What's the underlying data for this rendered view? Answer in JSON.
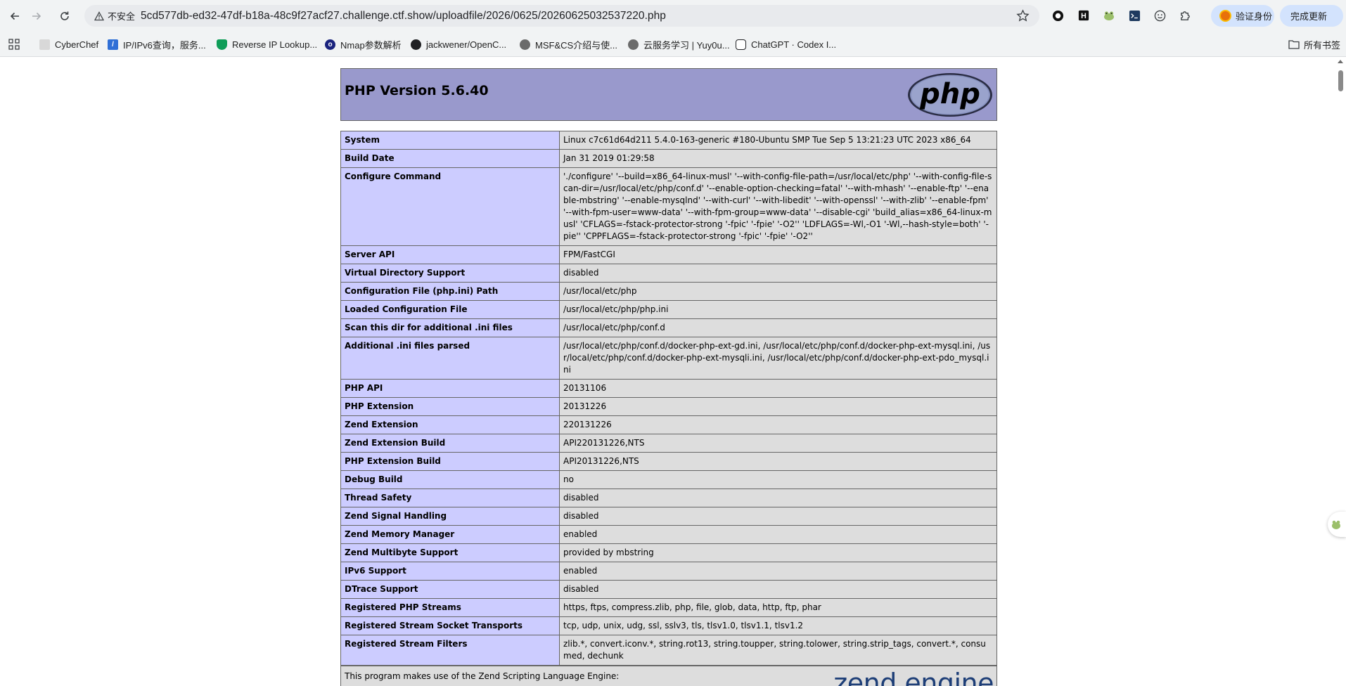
{
  "browser": {
    "security_label": "不安全",
    "url": "5cd577db-ed32-47df-b18a-48c9f27acf27.challenge.ctf.show/uploadfile/2026/0625/20260625032537220.php",
    "verify_label": "验证身份",
    "update_label": "完成更新",
    "all_bookmarks_label": "所有书签",
    "bookmarks": [
      {
        "label": "CyberChef",
        "icon": "chef-hat-icon",
        "color": "#c9c9c9"
      },
      {
        "label": "IP/IPv6查询，服务...",
        "icon": "ip-lookup-icon",
        "color": "#2f6fd6"
      },
      {
        "label": "Reverse IP Lookup...",
        "icon": "shield-icon",
        "color": "#0f9d58"
      },
      {
        "label": "Nmap参数解析",
        "icon": "nmap-icon",
        "color": "#1a237e"
      },
      {
        "label": "jackwener/OpenC...",
        "icon": "github-icon",
        "color": "#202124"
      },
      {
        "label": "MSF&CS介绍与使...",
        "icon": "avatar-icon",
        "color": "#5f6368"
      },
      {
        "label": "云服务学习 | Yuy0u...",
        "icon": "avatar-icon",
        "color": "#5f6368"
      },
      {
        "label": "ChatGPT · Codex I...",
        "icon": "openai-icon",
        "color": "#202124"
      }
    ]
  },
  "php": {
    "title": "PHP Version 5.6.40",
    "logo_text": "php",
    "rows": [
      {
        "key": "System",
        "value": "Linux c7c61d64d211 5.4.0-163-generic #180-Ubuntu SMP Tue Sep 5 13:21:23 UTC 2023 x86_64"
      },
      {
        "key": "Build Date",
        "value": "Jan 31 2019 01:29:58"
      },
      {
        "key": "Configure Command",
        "value": "'./configure' '--build=x86_64-linux-musl' '--with-config-file-path=/usr/local/etc/php' '--with-config-file-scan-dir=/usr/local/etc/php/conf.d' '--enable-option-checking=fatal' '--with-mhash' '--enable-ftp' '--enable-mbstring' '--enable-mysqlnd' '--with-curl' '--with-libedit' '--with-openssl' '--with-zlib' '--enable-fpm' '--with-fpm-user=www-data' '--with-fpm-group=www-data' '--disable-cgi' 'build_alias=x86_64-linux-musl' 'CFLAGS=-fstack-protector-strong '-fpic' '-fpie' '-O2'' 'LDFLAGS=-Wl,-O1 '-Wl,--hash-style=both' '-pie'' 'CPPFLAGS=-fstack-protector-strong '-fpic' '-fpie' '-O2''"
      },
      {
        "key": "Server API",
        "value": "FPM/FastCGI"
      },
      {
        "key": "Virtual Directory Support",
        "value": "disabled"
      },
      {
        "key": "Configuration File (php.ini) Path",
        "value": "/usr/local/etc/php"
      },
      {
        "key": "Loaded Configuration File",
        "value": "/usr/local/etc/php/php.ini"
      },
      {
        "key": "Scan this dir for additional .ini files",
        "value": "/usr/local/etc/php/conf.d"
      },
      {
        "key": "Additional .ini files parsed",
        "value": "/usr/local/etc/php/conf.d/docker-php-ext-gd.ini, /usr/local/etc/php/conf.d/docker-php-ext-mysql.ini, /usr/local/etc/php/conf.d/docker-php-ext-mysqli.ini, /usr/local/etc/php/conf.d/docker-php-ext-pdo_mysql.ini"
      },
      {
        "key": "PHP API",
        "value": "20131106"
      },
      {
        "key": "PHP Extension",
        "value": "20131226"
      },
      {
        "key": "Zend Extension",
        "value": "220131226"
      },
      {
        "key": "Zend Extension Build",
        "value": "API220131226,NTS"
      },
      {
        "key": "PHP Extension Build",
        "value": "API20131226,NTS"
      },
      {
        "key": "Debug Build",
        "value": "no"
      },
      {
        "key": "Thread Safety",
        "value": "disabled"
      },
      {
        "key": "Zend Signal Handling",
        "value": "disabled"
      },
      {
        "key": "Zend Memory Manager",
        "value": "enabled"
      },
      {
        "key": "Zend Multibyte Support",
        "value": "provided by mbstring"
      },
      {
        "key": "IPv6 Support",
        "value": "enabled"
      },
      {
        "key": "DTrace Support",
        "value": "disabled"
      },
      {
        "key": "Registered PHP Streams",
        "value": "https, ftps, compress.zlib, php, file, glob, data, http, ftp, phar"
      },
      {
        "key": "Registered Stream Socket Transports",
        "value": "tcp, udp, unix, udg, ssl, sslv3, tls, tlsv1.0, tlsv1.1, tlsv1.2"
      },
      {
        "key": "Registered Stream Filters",
        "value": "zlib.*, convert.iconv.*, string.rot13, string.toupper, string.tolower, string.strip_tags, convert.*, consumed, dechunk"
      }
    ],
    "zend_text": "This program makes use of the Zend Scripting Language Engine:",
    "zend_logo": "zend engine"
  },
  "colors": {
    "header_bg": "#9999cc",
    "key_bg": "#ccccff",
    "value_bg": "#dddddd",
    "border": "#666666"
  }
}
